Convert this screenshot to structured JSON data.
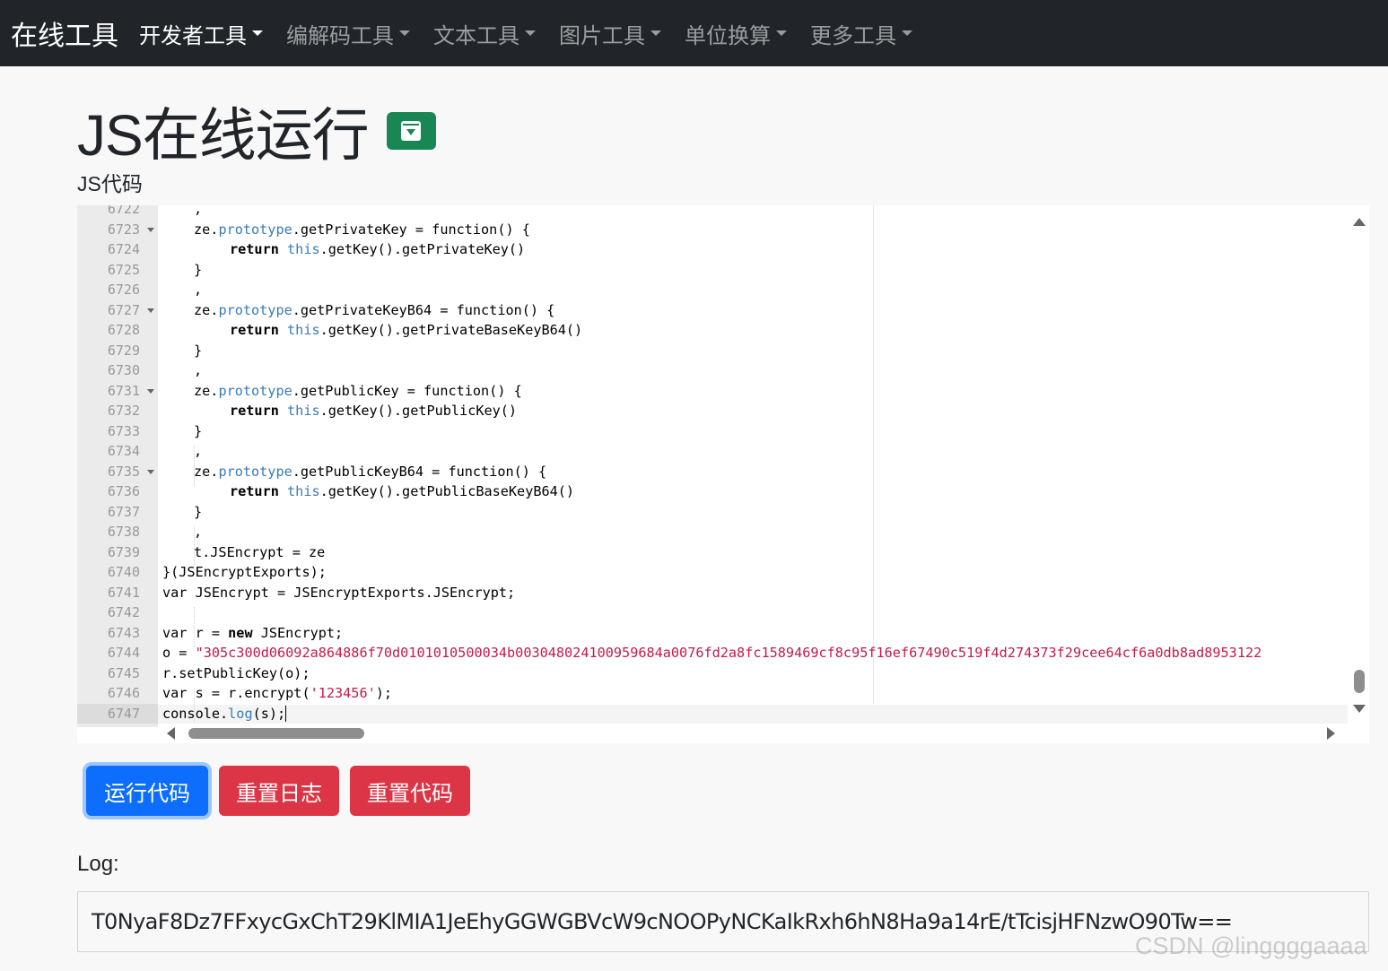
{
  "navbar": {
    "brand": "在线工具",
    "items": [
      {
        "label": "开发者工具",
        "active": true
      },
      {
        "label": "编解码工具",
        "active": false
      },
      {
        "label": "文本工具",
        "active": false
      },
      {
        "label": "图片工具",
        "active": false
      },
      {
        "label": "单位换算",
        "active": false
      },
      {
        "label": "更多工具",
        "active": false
      }
    ]
  },
  "page": {
    "title": "JS在线运行",
    "save_icon": "archive-download-icon",
    "code_label": "JS代码"
  },
  "editor": {
    "line_numbers": [
      "6722",
      "6723",
      "6724",
      "6725",
      "6726",
      "6727",
      "6728",
      "6729",
      "6730",
      "6731",
      "6732",
      "6733",
      "6734",
      "6735",
      "6736",
      "6737",
      "6738",
      "6739",
      "6740",
      "6741",
      "6742",
      "6743",
      "6744",
      "6745",
      "6746",
      "6747"
    ],
    "fold_lines": [
      "6723",
      "6727",
      "6731",
      "6735"
    ],
    "active_line": "6747",
    "lines": {
      "l6722": ",",
      "l6723_obj": "ze.",
      "l6723_proto": "prototype",
      "l6723_rest": ".getPrivateKey = function() {",
      "l6724_kw": "return",
      "l6724_this": "this",
      "l6724_rest": ".getKey().getPrivateKey()",
      "l6725": "}",
      "l6726": ",",
      "l6727_obj": "ze.",
      "l6727_proto": "prototype",
      "l6727_rest": ".getPrivateKeyB64 = function() {",
      "l6728_kw": "return",
      "l6728_this": "this",
      "l6728_rest": ".getKey().getPrivateBaseKeyB64()",
      "l6729": "}",
      "l6730": ",",
      "l6731_obj": "ze.",
      "l6731_proto": "prototype",
      "l6731_rest": ".getPublicKey = function() {",
      "l6732_kw": "return",
      "l6732_this": "this",
      "l6732_rest": ".getKey().getPublicKey()",
      "l6733": "}",
      "l6734": ",",
      "l6735_obj": "ze.",
      "l6735_proto": "prototype",
      "l6735_rest": ".getPublicKeyB64 = function() {",
      "l6736_kw": "return",
      "l6736_this": "this",
      "l6736_rest": ".getKey().getPublicBaseKeyB64()",
      "l6737": "}",
      "l6738": ",",
      "l6739": "t.JSEncrypt = ze",
      "l6740": "}(JSEncryptExports);",
      "l6741": "var JSEncrypt = JSEncryptExports.JSEncrypt;",
      "l6743_pre": "var r = ",
      "l6743_kw": "new",
      "l6743_rest": " JSEncrypt;",
      "l6744_pre": "o = ",
      "l6744_str": "\"305c300d06092a864886f70d0101010500034b003048024100959684a0076fd2a8fc1589469cf8c95f16ef67490c519f4d274373f29cee64cf6a0db8ad8953122",
      "l6745": "r.setPublicKey(o);",
      "l6746_pre": "var s = r.encrypt(",
      "l6746_str": "'123456'",
      "l6746_rest": ");",
      "l6747_pre": "console.",
      "l6747_fn": "log",
      "l6747_rest": "(s);"
    }
  },
  "buttons": {
    "run": "运行代码",
    "reset_log": "重置日志",
    "reset_code": "重置代码"
  },
  "log": {
    "label": "Log:",
    "output": "T0NyaF8Dz7FFxycGxChT29KlMIA1JeEhyGGWGBVcW9cNOOPyNCKaIkRxh6hN8Ha9a14rE/tTcisjHFNzwO90Tw=="
  },
  "watermark": "CSDN @linggggaaaa",
  "colors": {
    "navbar_bg": "#212529",
    "primary": "#0d6efd",
    "danger": "#dc3545",
    "success": "#198754",
    "string": "#c41a4a",
    "keyword_blue": "#3a7bb8"
  }
}
